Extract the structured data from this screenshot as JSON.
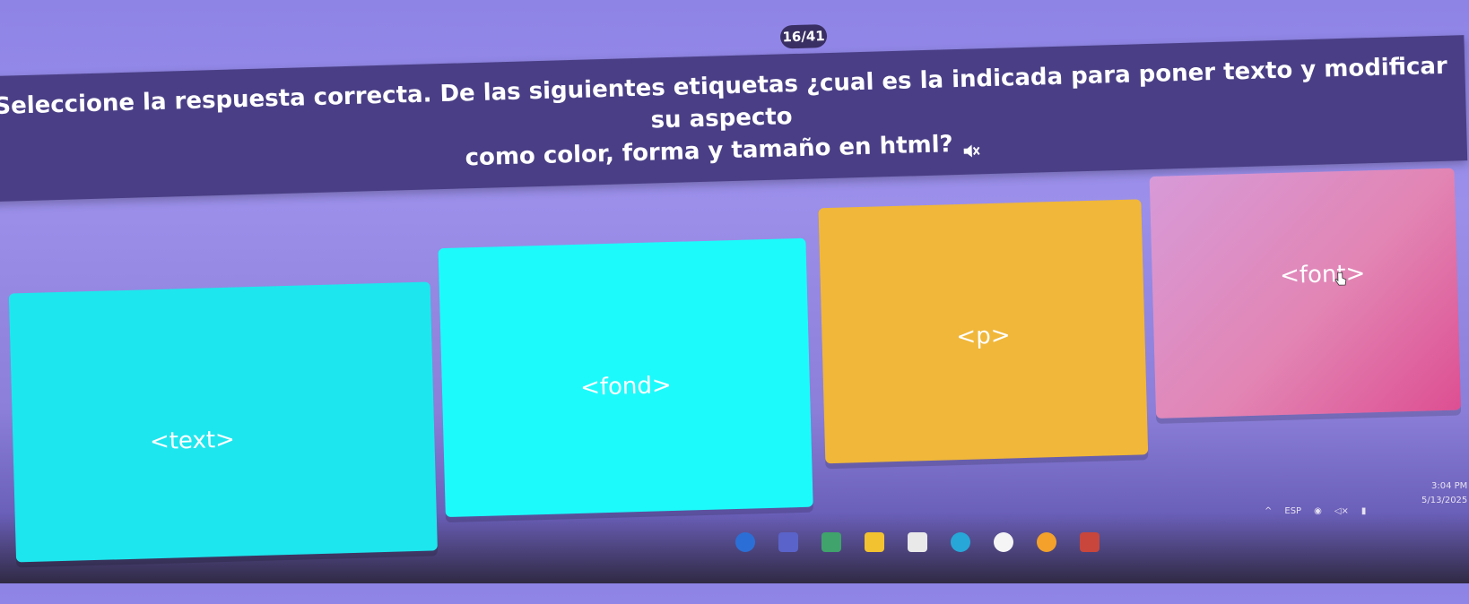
{
  "counter": "16/41",
  "question": {
    "line1": "Seleccione la respuesta correcta. De las siguientes etiquetas ¿cual es la indicada para poner texto y modificar su aspecto",
    "line2": "como color, forma y tamaño en html?"
  },
  "options": [
    {
      "label": "<text>",
      "color": "#1ee6ee"
    },
    {
      "label": "<fond>",
      "color": "#1dfafc"
    },
    {
      "label": "<p>",
      "color": "#f0b73a"
    },
    {
      "label": "<font>",
      "color": "#e285b4"
    }
  ],
  "tray": {
    "language": "ESP",
    "time": "3:04 PM",
    "date": "5/13/2025"
  },
  "taskbar_icons": [
    "browser-icon",
    "teams-icon",
    "app-icon",
    "files-icon",
    "calendar-icon",
    "chrome-icon",
    "circle-icon",
    "opera-icon",
    "office-icon"
  ]
}
